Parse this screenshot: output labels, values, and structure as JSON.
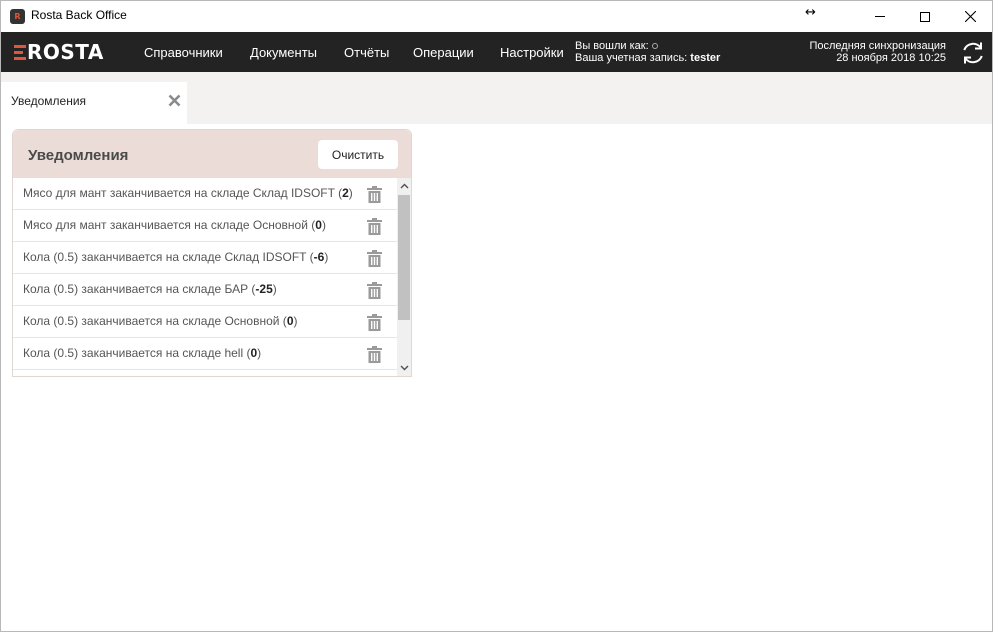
{
  "window": {
    "title": "Rosta Back Office",
    "app_icon_text": "R",
    "resize_glyph": "↔"
  },
  "navbar": {
    "logo": "ROSTA",
    "items": [
      "Справочники",
      "Документы",
      "Отчёты",
      "Операции",
      "Настройки"
    ],
    "user": {
      "logged_in_label": "Вы вошли как:",
      "account_label": "Ваша учетная запись:",
      "account_name": "tester"
    },
    "sync": {
      "label": "Последняя синхронизация",
      "datetime": "28 ноября 2018 10:25"
    }
  },
  "tabs": [
    {
      "label": "Уведомления",
      "active": true
    }
  ],
  "notifications": {
    "title": "Уведомления",
    "clear_label": "Очистить",
    "items": [
      {
        "text": "Мясо для мант заканчивается на складе Склад IDSOFT",
        "value": "2"
      },
      {
        "text": "Мясо для мант заканчивается на складе Основной",
        "value": "0"
      },
      {
        "text": "Кола (0.5) заканчивается на складе Склад IDSOFT",
        "value": "-6"
      },
      {
        "text": "Кола (0.5) заканчивается на складе БАР",
        "value": "-25"
      },
      {
        "text": "Кола (0.5) заканчивается на складе Основной",
        "value": "0"
      },
      {
        "text": "Кола (0.5) заканчивается на складе hell",
        "value": "0"
      }
    ]
  },
  "colors": {
    "accent": "#e0563a",
    "navbar_bg": "#232323",
    "panel_header_bg": "#ebdcd8"
  }
}
